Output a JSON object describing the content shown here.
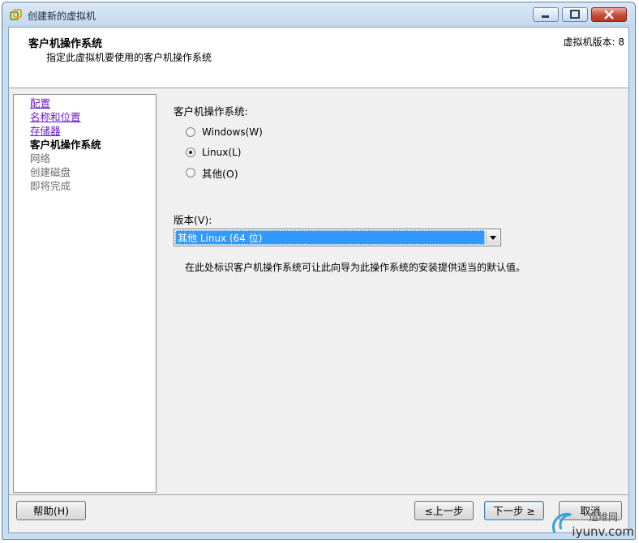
{
  "window": {
    "title": "创建新的虚拟机",
    "icon": "vmware-new-vm-icon"
  },
  "header": {
    "title": "客户机操作系统",
    "subtitle": "指定此虚拟机要使用的客户机操作系统",
    "version": "虚拟机版本: 8"
  },
  "nav": {
    "items": [
      {
        "label": "配置",
        "state": "link"
      },
      {
        "label": "名称和位置",
        "state": "link"
      },
      {
        "label": "存储器",
        "state": "link"
      },
      {
        "label": "客户机操作系统",
        "state": "current"
      },
      {
        "label": "网络",
        "state": "disabled"
      },
      {
        "label": "创建磁盘",
        "state": "disabled"
      },
      {
        "label": "即将完成",
        "state": "disabled"
      }
    ]
  },
  "guest_os": {
    "label": "客户机操作系统:",
    "options": [
      {
        "label": "Windows(W)",
        "checked": false
      },
      {
        "label": "Linux(L)",
        "checked": true
      },
      {
        "label": "其他(O)",
        "checked": false
      }
    ]
  },
  "version": {
    "label": "版本(V):",
    "selected": "其他 Linux (64 位)"
  },
  "hint": "在此处标识客户机操作系统可让此向导为此操作系统的安装提供适当的默认值。",
  "footer": {
    "help_label": "帮助(H)",
    "back_label": "≤上一步",
    "next_label": "下一步 ≥",
    "cancel_label": "取消"
  },
  "watermark": {
    "top": "运维网",
    "bottom": "iyunv.com"
  }
}
